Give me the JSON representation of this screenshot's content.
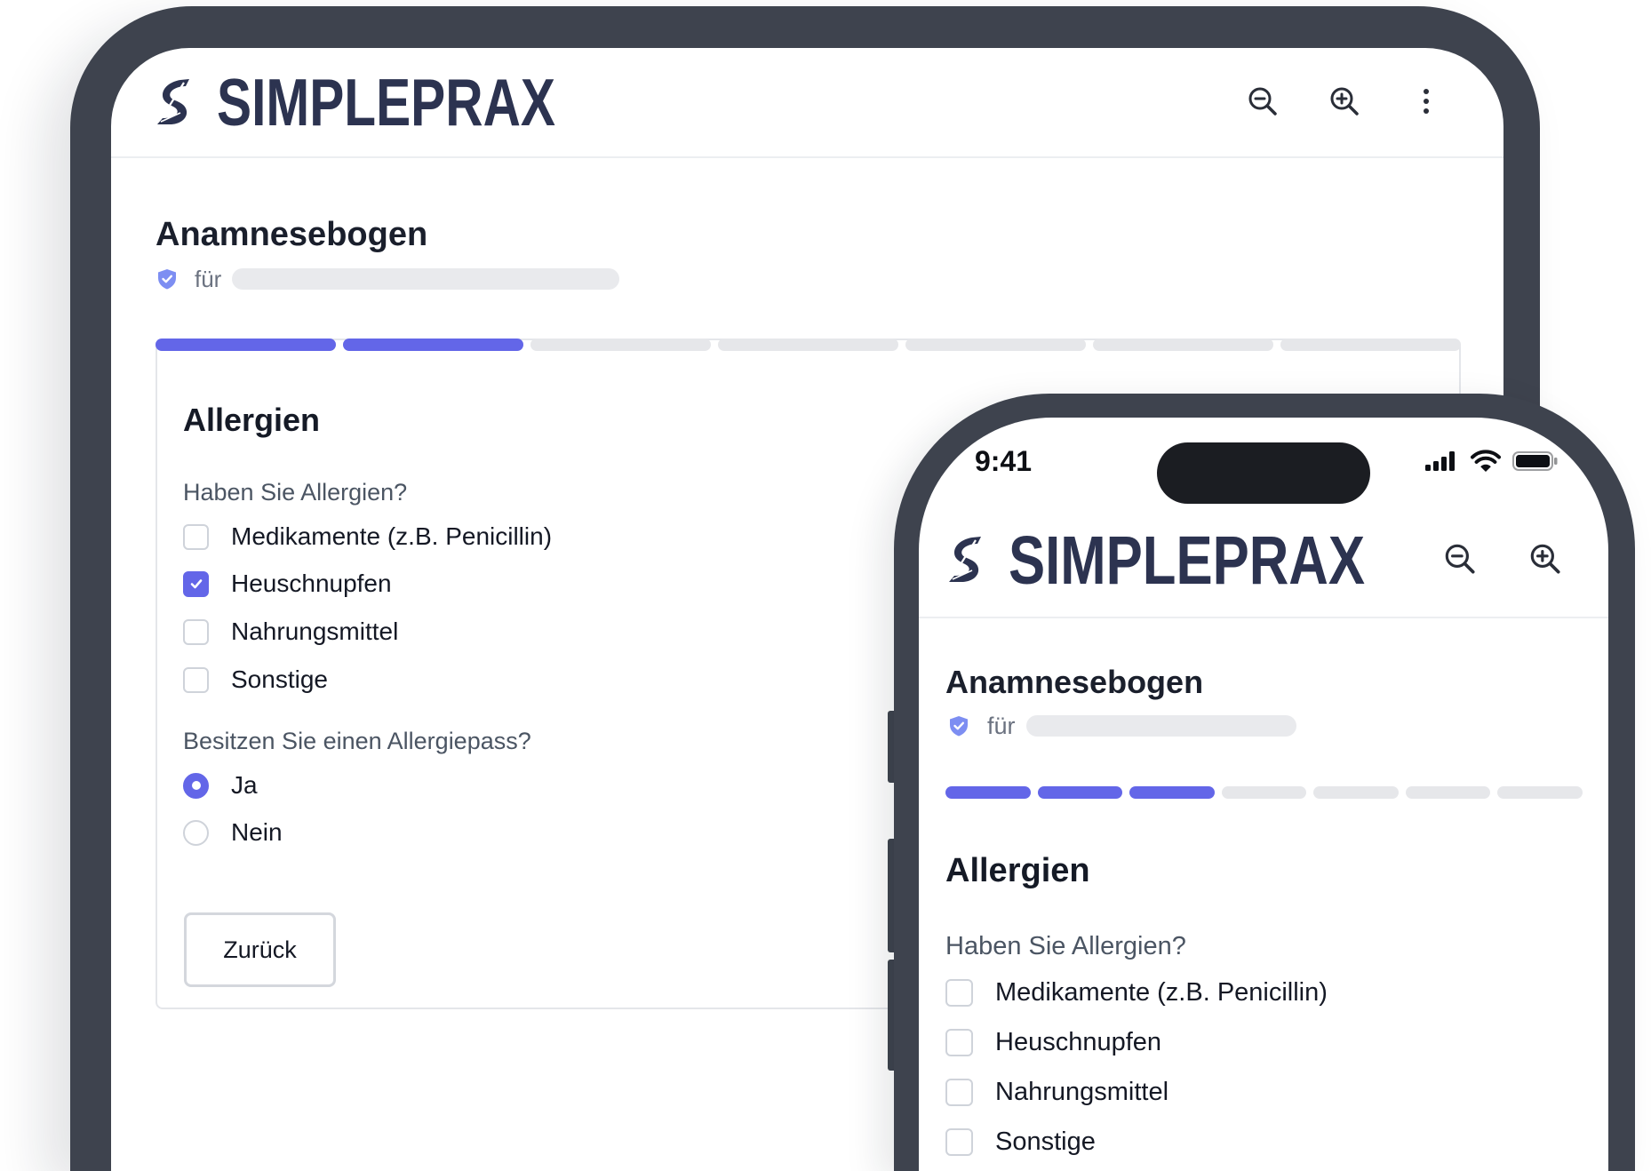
{
  "colors": {
    "frame": "#3e434e",
    "accent": "#6366e8",
    "brand": "#2c3350",
    "progress_empty": "#e6e7ea"
  },
  "tablet": {
    "header": {
      "logo_icon": "simpleprax-logo-icon",
      "brand": "SIMPLEPRAX",
      "actions": [
        {
          "icon": "zoom-out-icon"
        },
        {
          "icon": "zoom-in-icon"
        },
        {
          "icon": "more-vertical-icon"
        }
      ]
    },
    "form": {
      "title": "Anamnesebogen",
      "verified_icon": "shield-check-icon",
      "for_label": "für",
      "progress": {
        "total_steps": 7,
        "completed_steps": 2
      },
      "section": {
        "title": "Allergien",
        "question_1": {
          "label": "Haben Sie Allergien?",
          "options": [
            {
              "label": "Medikamente (z.B. Penicillin)",
              "checked": false
            },
            {
              "label": "Heuschnupfen",
              "checked": true
            },
            {
              "label": "Nahrungsmittel",
              "checked": false
            },
            {
              "label": "Sonstige",
              "checked": false
            }
          ]
        },
        "question_2": {
          "label": "Besitzen Sie einen Allergiepass?",
          "options": [
            {
              "label": "Ja",
              "selected": true
            },
            {
              "label": "Nein",
              "selected": false
            }
          ]
        }
      },
      "back_button": "Zurück"
    }
  },
  "phone": {
    "status_bar": {
      "time": "9:41",
      "icons": [
        "signal-icon",
        "wifi-icon",
        "battery-icon"
      ]
    },
    "header": {
      "logo_icon": "simpleprax-logo-icon",
      "brand": "SIMPLEPRAX",
      "actions": [
        {
          "icon": "zoom-out-icon"
        },
        {
          "icon": "zoom-in-icon"
        }
      ]
    },
    "form": {
      "title": "Anamnesebogen",
      "verified_icon": "shield-check-icon",
      "for_label": "für",
      "progress": {
        "total_steps": 7,
        "completed_steps": 3
      },
      "section": {
        "title": "Allergien",
        "question_1": {
          "label": "Haben Sie Allergien?",
          "options": [
            {
              "label": "Medikamente (z.B. Penicillin)",
              "checked": false
            },
            {
              "label": "Heuschnupfen",
              "checked": false
            },
            {
              "label": "Nahrungsmittel",
              "checked": false
            },
            {
              "label": "Sonstige",
              "checked": false
            }
          ]
        }
      }
    }
  }
}
